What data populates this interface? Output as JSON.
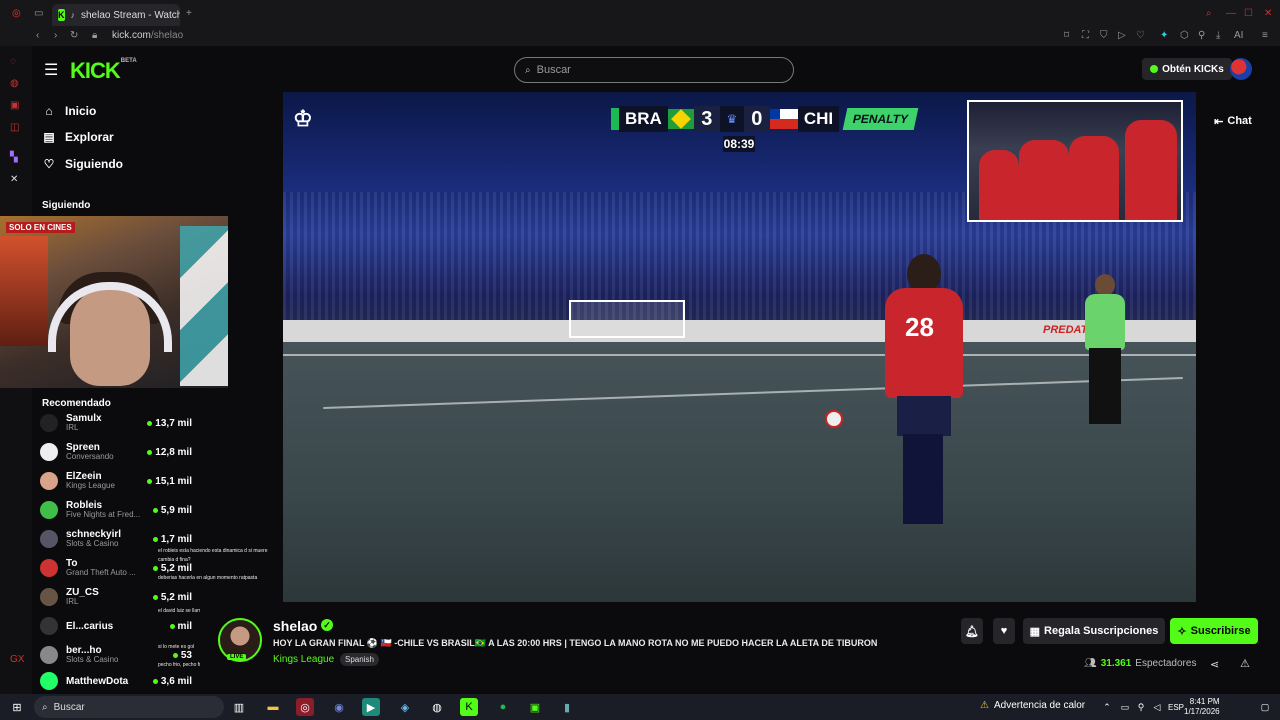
{
  "browser": {
    "tab_title": "shelao Stream - Watch",
    "url_host": "kick.com",
    "url_path": "/shelao",
    "ai_label": "AI"
  },
  "header": {
    "logo": "KICK",
    "logo_badge": "BETA",
    "search_placeholder": "Buscar",
    "kicks_button": "Obtén KICKs"
  },
  "nav": {
    "items": [
      {
        "label": "Inicio",
        "icon": "home-icon"
      },
      {
        "label": "Explorar",
        "icon": "compass-icon"
      },
      {
        "label": "Siguiendo",
        "icon": "heart-icon"
      }
    ],
    "following_title": "Siguiendo",
    "recommended_title": "Recomendado",
    "recommended": [
      {
        "name": "Samulx",
        "category": "IRL",
        "viewers": "13,7 mil"
      },
      {
        "name": "Spreen",
        "category": "Conversando",
        "viewers": "12,8 mil"
      },
      {
        "name": "ElZeein",
        "category": "Kings League",
        "viewers": "15,1 mil"
      },
      {
        "name": "Robleis",
        "category": "Five Nights at Fred...",
        "viewers": "5,9 mil"
      },
      {
        "name": "schneckyirl",
        "category": "Slots & Casino",
        "viewers": "1,7 mil"
      },
      {
        "name": "To",
        "category": "Grand Theft Auto ...",
        "viewers": "5,2 mil"
      },
      {
        "name": "ZU_CS",
        "category": "IRL",
        "viewers": "5,2 mil"
      },
      {
        "name": "El...carius",
        "category": "",
        "viewers": "mil"
      },
      {
        "name": "ber...ho",
        "category": "Slots & Casino",
        "viewers": "53"
      },
      {
        "name": "MatthewDota",
        "category": "",
        "viewers": "3,6 mil"
      }
    ]
  },
  "webcam": {
    "banner": "SOLO EN CINES"
  },
  "chat_overlay": [
    "el robleis esta haciendo esta dinamica d si muere",
    "cambia d fina?",
    "deberias hacerla en algun momento ratpasta",
    "el david luiz se llama dedo XD",
    "si lo mete es gol",
    "pecho frio, pecho frio ahora van a perder"
  ],
  "scoreboard": {
    "home": "BRA",
    "home_score": "3",
    "away_score": "0",
    "away": "CHI",
    "tag": "PENALTY",
    "clock": "08:39"
  },
  "player": {
    "number": "28"
  },
  "ad_text": "PREDATOR",
  "chat_button": "Chat",
  "stream": {
    "channel": "shelao",
    "title": "HOY LA GRAN FINAL ⚽ 🇨🇱 -CHILE VS BRASIL🇧🇷 A LAS 20:00 HRS | TENGO LA MANO ROTA NO ME PUEDO HACER LA ALETA DE TIBURON",
    "category": "Kings League",
    "language": "Spanish",
    "live_badge": "LIVE",
    "viewers_count": "31.361",
    "viewers_label": "Espectadores",
    "gift_button": "Regala Suscripciones",
    "subscribe_button": "Suscribirse"
  },
  "taskbar": {
    "search_placeholder": "Buscar",
    "weather": "Advertencia de calor",
    "lang": "ESP",
    "time": "8:41 PM",
    "date": "1/17/2026"
  },
  "colors": {
    "accent": "#53fc18",
    "bg": "#0b0b0d"
  }
}
